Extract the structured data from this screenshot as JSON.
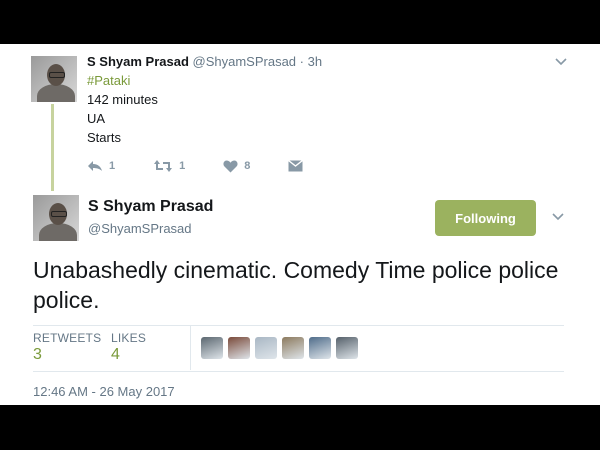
{
  "parent_tweet": {
    "display_name": "S Shyam Prasad",
    "handle": "@ShyamSPrasad",
    "time": "· 3h",
    "lines": [
      "#Pataki",
      "142 minutes",
      "UA",
      "Starts"
    ],
    "actions": {
      "reply_count": "1",
      "retweet_count": "1",
      "like_count": "8"
    }
  },
  "main_tweet": {
    "display_name": "S Shyam Prasad",
    "handle": "@ShyamSPrasad",
    "follow_label": "Following",
    "text": "Unabashedly cinematic. Comedy Time police police police.",
    "stats": {
      "retweets_label": "RETWEETS",
      "retweets_value": "3",
      "likes_label": "LIKES",
      "likes_value": "4"
    },
    "liker_avatars": [
      {
        "color": "#5b6770"
      },
      {
        "color": "#7a4a3a"
      },
      {
        "color": "#a9b7c4"
      },
      {
        "color": "#8c7a5e"
      },
      {
        "color": "#4f6c8a"
      },
      {
        "color": "#55606a"
      }
    ],
    "timestamp": "12:46 AM - 26 May 2017"
  },
  "colors": {
    "accent": "#9bb25f",
    "link": "#7a9a3a",
    "thread_line": "#c7d39e"
  }
}
